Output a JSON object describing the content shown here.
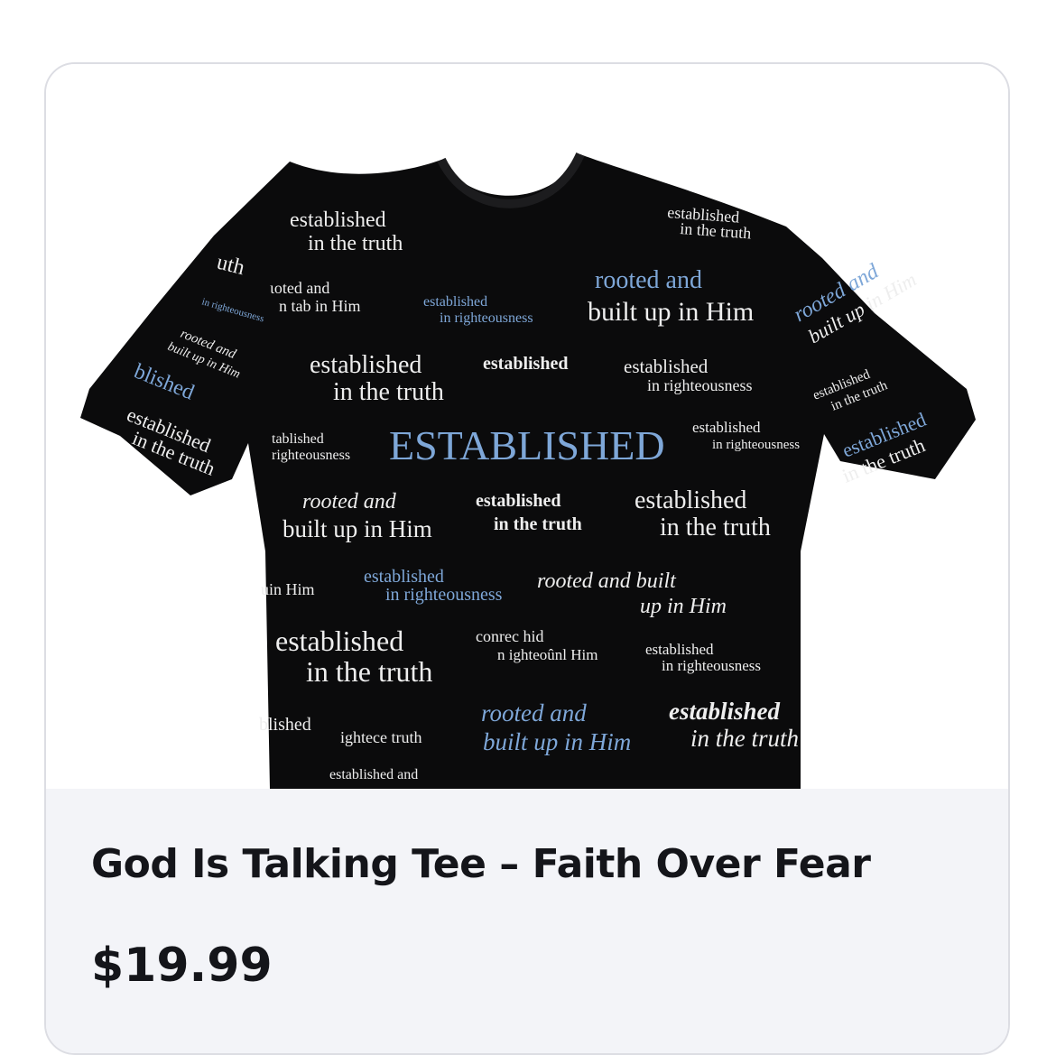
{
  "product": {
    "title": "God Is Talking Tee – Faith Over Fear",
    "price": "$19.99",
    "image": {
      "garment": "black t-shirt",
      "garment_color": "#0b0b0c",
      "print_white": "#eeeeee",
      "print_blue": "#7ea7d8",
      "print_text": {
        "headline": "ESTABLISHED",
        "established": "established",
        "in_the_truth": "in the truth",
        "rooted_and": "rooted and",
        "built_up_in_him": "built up in Him",
        "in_righteousness": "in righteousness",
        "rooted_and_built": "rooted and built",
        "up_in_him": "up in Him",
        "established_and": "established and",
        "conrec_hid": "conrec hid",
        "n_ighteount_him": "n ighteoûnl Him",
        "ightecs_truth": "ightece truth",
        "in_tab_in_him": "n tab in Him",
        "toted_and": "ɩoted and",
        "tablished": "tablished",
        "righteousness": "righteousness",
        "uin_him": "uin Him",
        "blished": "blished",
        "uth": "uth"
      }
    }
  },
  "colors": {
    "card_border": "#dcdde3",
    "info_bg": "#f3f4f8",
    "text": "#14151a"
  }
}
